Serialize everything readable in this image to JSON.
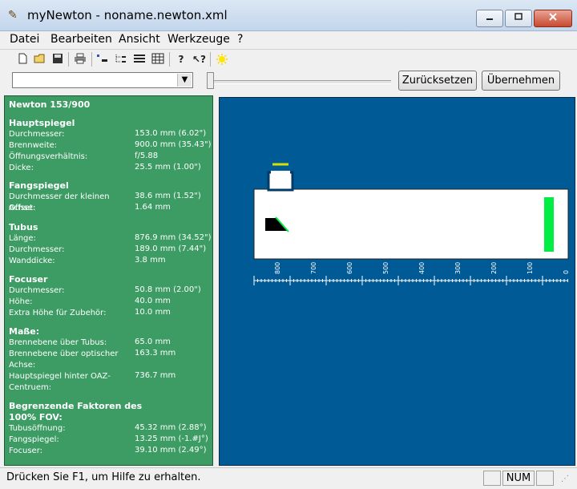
{
  "window": {
    "title": "myNewton - noname.newton.xml"
  },
  "menu": [
    "Datei",
    "Bearbeiten",
    "Ansicht",
    "Werkzeuge",
    "?"
  ],
  "buttons": {
    "reset": "Zurücksetzen",
    "apply": "Übernehmen"
  },
  "combo": {
    "value": ""
  },
  "panel": {
    "title": "Newton 153/900",
    "sections": [
      {
        "heading": "Hauptspiegel",
        "rows": [
          {
            "label": "Durchmesser:",
            "value": "153.0 mm (6.02\")"
          },
          {
            "label": "Brennweite:",
            "value": "900.0 mm (35.43\")"
          },
          {
            "label": "Öffnungsverhältnis:",
            "value": "f/5.88"
          },
          {
            "label": "Dicke:",
            "value": "25.5 mm (1.00\")"
          }
        ]
      },
      {
        "heading": "Fangspiegel",
        "rows": [
          {
            "label": "Durchmesser der kleinen Achse:",
            "value": "38.6 mm (1.52\")"
          },
          {
            "label": "Offset:",
            "value": "1.64 mm"
          }
        ]
      },
      {
        "heading": "Tubus",
        "rows": [
          {
            "label": "Länge:",
            "value": "876.9 mm (34.52\")"
          },
          {
            "label": "Durchmesser:",
            "value": "189.0 mm (7.44\")"
          },
          {
            "label": "Wanddicke:",
            "value": "3.8 mm"
          }
        ]
      },
      {
        "heading": "Focuser",
        "rows": [
          {
            "label": "Durchmesser:",
            "value": "50.8 mm (2.00\")"
          },
          {
            "label": "Höhe:",
            "value": "40.0 mm"
          },
          {
            "label": "Extra Höhe für Zubehör:",
            "value": "10.0 mm"
          }
        ]
      },
      {
        "heading": "Maße:",
        "rows": [
          {
            "label": "Brennebene über Tubus:",
            "value": "65.0 mm"
          },
          {
            "label": "Brennebene über optischer Achse:",
            "value": "163.3 mm"
          },
          {
            "label": "Hauptspiegel hinter OAZ-Centruem:",
            "value": "736.7 mm"
          }
        ]
      },
      {
        "heading": "Begrenzende Faktoren des 100% FOV:",
        "rows": [
          {
            "label": "Tubusöffnung:",
            "value": "45.32 mm  (2.88°)"
          },
          {
            "label": "Fangspiegel:",
            "value": "13.25 mm  (-1.#J°)"
          },
          {
            "label": "Focuser:",
            "value": "39.10 mm  (2.49°)"
          }
        ]
      }
    ]
  },
  "ruler": {
    "labels": [
      "800",
      "700",
      "600",
      "500",
      "400",
      "300",
      "200",
      "100",
      "0"
    ]
  },
  "status": {
    "text": "Drücken Sie F1, um Hilfe zu erhalten.",
    "num": "NUM"
  },
  "colors": {
    "panel_bg": "#3c9c64",
    "canvas_bg": "#005a95",
    "mirror": "#00ee44"
  },
  "icons": [
    "new-file-icon",
    "open-folder-icon",
    "save-icon",
    "print-icon",
    "text-view-icon",
    "tree-view-icon",
    "list-view-icon",
    "detail-view-icon",
    "help-icon",
    "context-help-icon",
    "sun-icon"
  ]
}
